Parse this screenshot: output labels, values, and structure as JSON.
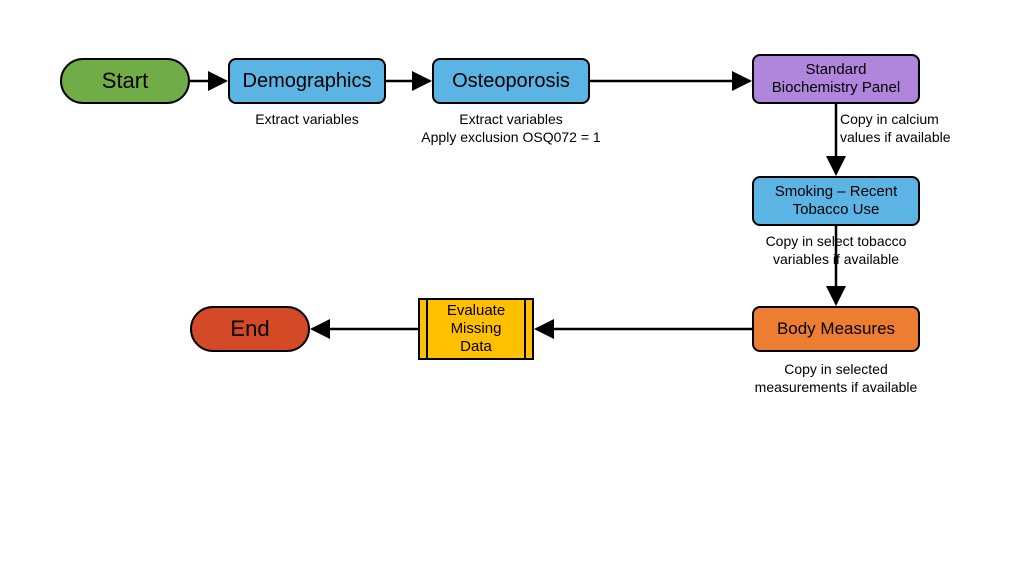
{
  "nodes": {
    "start": {
      "label": "Start"
    },
    "demographics": {
      "label": "Demographics",
      "caption": "Extract variables"
    },
    "osteoporosis": {
      "label": "Osteoporosis",
      "caption": "Extract variables\nApply exclusion OSQ072 = 1"
    },
    "biochem": {
      "label": "Standard\nBiochemistry Panel",
      "caption": "Copy in calcium\nvalues if available"
    },
    "smoking": {
      "label": "Smoking – Recent\nTobacco Use",
      "caption": "Copy in select tobacco\nvariables if available"
    },
    "body": {
      "label": "Body Measures",
      "caption": "Copy in selected\nmeasurements if available"
    },
    "evaluate": {
      "label": "Evaluate\nMissing\nData"
    },
    "end": {
      "label": "End"
    }
  },
  "colors": {
    "start": "#70ad47",
    "process_blue": "#5cb4e4",
    "biochem": "#b085dc",
    "body": "#ed7d31",
    "predef": "#ffc000",
    "end": "#d44a27"
  }
}
